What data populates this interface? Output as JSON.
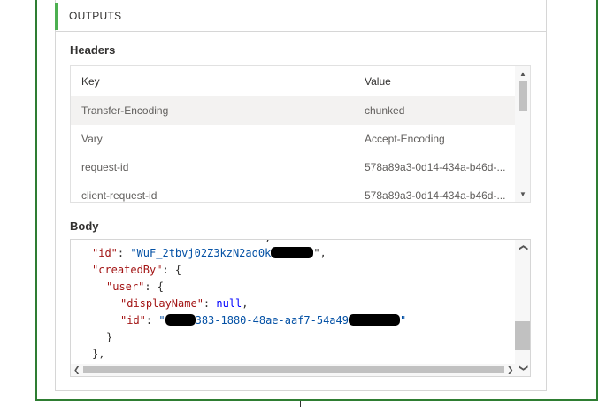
{
  "outputs": {
    "title": "OUTPUTS"
  },
  "headers": {
    "label": "Headers",
    "columns": {
      "key": "Key",
      "value": "Value"
    },
    "rows": [
      {
        "key": "Transfer-Encoding",
        "value": "chunked"
      },
      {
        "key": "Vary",
        "value": "Accept-Encoding"
      },
      {
        "key": "request-id",
        "value": "578a89a3-0d14-434a-b46d-..."
      },
      {
        "key": "client-request-id",
        "value": "578a89a3-0d14-434a-b46d-..."
      }
    ]
  },
  "body": {
    "label": "Body",
    "lines": {
      "l1_key": "\"id\"",
      "l1_val": "\"WuF_2tbvj02Z3kzN2ao0k",
      "l1_end": "\",",
      "l2_key": "\"createdBy\"",
      "l2_rest": ": {",
      "l3_key": "\"user\"",
      "l3_rest": ": {",
      "l4_key": "\"displayName\"",
      "l4_colon": ": ",
      "l4_val": "null",
      "l4_end": ",",
      "l5_key": "\"id\"",
      "l5_colon": ": ",
      "l5_val_a": "\"",
      "l5_val_b": "383-1880-48ae-aaf7-54a49",
      "l5_val_c": "\"",
      "l6": "}",
      "l7": "},"
    }
  },
  "icons": {
    "scroll_up": "▲",
    "scroll_down": "▼",
    "scroll_left": "❮",
    "scroll_right": "❯",
    "chevron_up": "❮",
    "chevron_down": "❯"
  }
}
